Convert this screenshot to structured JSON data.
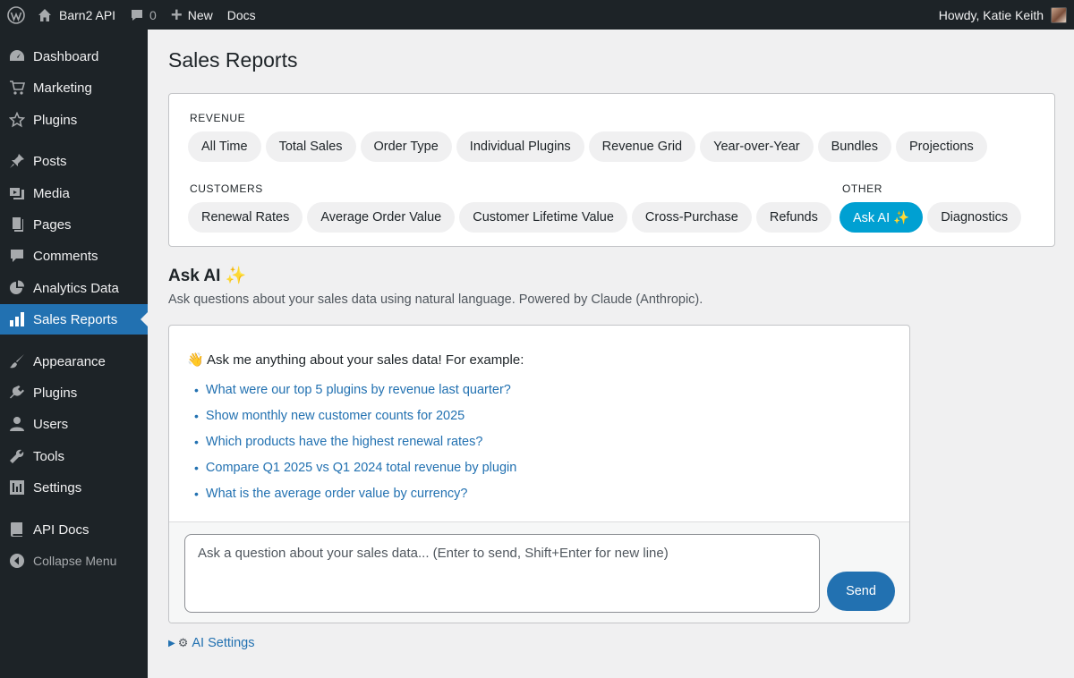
{
  "adminbar": {
    "wp_icon": "wordpress-logo-icon",
    "site_name": "Barn2 API",
    "comments_count": "0",
    "new_label": "New",
    "docs_label": "Docs",
    "howdy": "Howdy, Katie Keith"
  },
  "sidebar": {
    "items": [
      {
        "label": "Dashboard",
        "icon": "dashboard-icon"
      },
      {
        "label": "Marketing",
        "icon": "cart-icon"
      },
      {
        "label": "Plugins",
        "icon": "star-icon"
      },
      {
        "label": "Posts",
        "icon": "pin-icon"
      },
      {
        "label": "Media",
        "icon": "media-icon"
      },
      {
        "label": "Pages",
        "icon": "pages-icon"
      },
      {
        "label": "Comments",
        "icon": "comment-icon"
      },
      {
        "label": "Analytics Data",
        "icon": "pie-chart-icon"
      },
      {
        "label": "Sales Reports",
        "icon": "bar-chart-icon"
      },
      {
        "label": "Appearance",
        "icon": "brush-icon"
      },
      {
        "label": "Plugins",
        "icon": "plugin-icon"
      },
      {
        "label": "Users",
        "icon": "user-icon"
      },
      {
        "label": "Tools",
        "icon": "wrench-icon"
      },
      {
        "label": "Settings",
        "icon": "settings-icon"
      },
      {
        "label": "API Docs",
        "icon": "book-icon"
      },
      {
        "label": "Collapse Menu",
        "icon": "collapse-icon"
      }
    ],
    "current": "Sales Reports"
  },
  "page": {
    "title": "Sales Reports"
  },
  "filters": {
    "revenue_label": "REVENUE",
    "revenue": [
      "All Time",
      "Total Sales",
      "Order Type",
      "Individual Plugins",
      "Revenue Grid",
      "Year-over-Year",
      "Bundles",
      "Projections"
    ],
    "customers_label": "CUSTOMERS",
    "customers": [
      "Renewal Rates",
      "Average Order Value",
      "Customer Lifetime Value",
      "Cross-Purchase",
      "Refunds"
    ],
    "other_label": "OTHER",
    "other": [
      "Ask AI ✨",
      "Diagnostics"
    ],
    "active": "Ask AI ✨"
  },
  "ask_ai": {
    "title": "Ask AI",
    "title_emoji": "✨",
    "description": "Ask questions about your sales data using natural language. Powered by Claude (Anthropic).",
    "intro": "👋 Ask me anything about your sales data! For example:",
    "examples": [
      "What were our top 5 plugins by revenue last quarter?",
      "Show monthly new customer counts for 2025",
      "Which products have the highest renewal rates?",
      "Compare Q1 2025 vs Q1 2024 total revenue by plugin",
      "What is the average order value by currency?"
    ],
    "input_placeholder": "Ask a question about your sales data... (Enter to send, Shift+Enter for new line)",
    "input_value": "",
    "send_label": "Send",
    "settings_label": "AI Settings"
  },
  "colors": {
    "admin_bg": "#1d2327",
    "accent": "#2271b1",
    "active_pill": "#00a0d2"
  }
}
